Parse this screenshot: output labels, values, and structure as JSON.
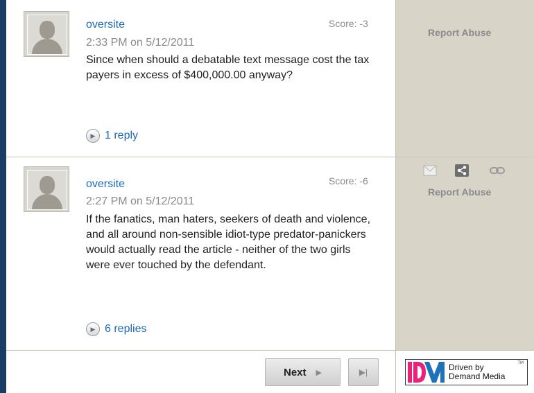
{
  "comments": [
    {
      "username": "oversite",
      "score": "Score: -3",
      "timestamp": "2:33 PM on 5/12/2011",
      "text": "Since when should a debatable text message cost the tax payers in excess of $400,000.00 anyway?",
      "replies": "1 reply",
      "report": "Report Abuse"
    },
    {
      "username": "oversite",
      "score": "Score: -6",
      "timestamp": "2:27 PM on 5/12/2011",
      "text": "If the fanatics, man haters, seekers of death and violence, and all around non-sensible idiot-type predator-panickers would actually read the article - neither of the two girls were ever touched by the defendant.",
      "replies": "6 replies",
      "report": "Report Abuse",
      "share_icons": [
        "email-icon",
        "share-icon",
        "link-icon"
      ]
    }
  ],
  "pagination": {
    "next_label": "Next",
    "next_arrow": "▶",
    "last_arrow": "▶|"
  },
  "footer_logo": {
    "mark": "DM",
    "line1": "Driven by",
    "line2": "Demand Media",
    "tm": "TM"
  },
  "colors": {
    "accent_bar": "#1a3d66",
    "link": "#1a6bb5",
    "sidebar_bg": "#d8d4c8",
    "logo_pink": "#e8237a",
    "logo_blue": "#1e72b8"
  }
}
